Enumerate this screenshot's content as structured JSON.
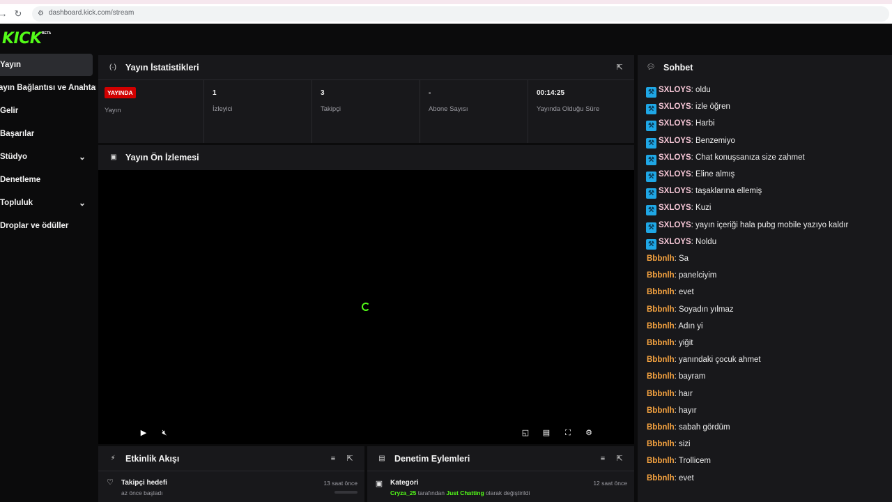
{
  "browser": {
    "back_icon": "back-arrow-icon",
    "reload_icon": "reload-icon",
    "url": "dashboard.kick.com/stream"
  },
  "brand": {
    "logo": "KICK",
    "beta": "BETA",
    "color": "#53fc18"
  },
  "sidebar": {
    "items": [
      {
        "label": "Yayın"
      },
      {
        "label": "Yayın Bağlantısı ve Anahtarı"
      },
      {
        "label": "Gelir"
      },
      {
        "label": "Başarılar"
      },
      {
        "label": "Stüdyo"
      },
      {
        "label": "Denetleme"
      },
      {
        "label": "Topluluk"
      },
      {
        "label": "Droplar ve ödüller"
      }
    ]
  },
  "stats": {
    "title": "Yayın İstatistikleri",
    "live_badge": "YAYINDA",
    "cells": [
      {
        "value": "",
        "label": "Yayın"
      },
      {
        "value": "1",
        "label": "İzleyici"
      },
      {
        "value": "3",
        "label": "Takipçi"
      },
      {
        "value": "-",
        "label": "Abone Sayısı"
      },
      {
        "value": "00:14:25",
        "label": "Yayında Olduğu Süre"
      }
    ]
  },
  "preview": {
    "title": "Yayın Ön İzlemesi"
  },
  "activity": {
    "title": "Etkinlik Akışı",
    "row_title": "Takipçi hedefi",
    "row_sub": "az önce başladı",
    "row_time": "13 saat önce"
  },
  "moderation": {
    "title": "Denetim Eylemleri",
    "row_title": "Kategori",
    "row_user": "Cryza_25",
    "row_mid": " tarafından ",
    "row_category": "Just Chatting",
    "row_end": " olarak değiştirildi",
    "row_time": "12 saat önce"
  },
  "chat": {
    "title": "Sohbet",
    "messages": [
      {
        "user": "SXLOYS",
        "text": ": oldu"
      },
      {
        "user": "SXLOYS",
        "text": ": izle öğren"
      },
      {
        "user": "SXLOYS",
        "text": ": Harbi"
      },
      {
        "user": "SXLOYS",
        "text": ": Benzemiyo"
      },
      {
        "user": "SXLOYS",
        "text": ": Chat konuşsanıza size zahmet"
      },
      {
        "user": "SXLOYS",
        "text": ": Eline almış"
      },
      {
        "user": "SXLOYS",
        "text": ": taşaklarına ellemiş"
      },
      {
        "user": "SXLOYS",
        "text": ": Kuzi"
      },
      {
        "user": "SXLOYS",
        "text": ": yayın içeriği hala pubg mobile yazıyo kaldır"
      },
      {
        "user": "SXLOYS",
        "text": ": Noldu"
      },
      {
        "user": "Bbbnlh",
        "text": ": Sa"
      },
      {
        "user": "Bbbnlh",
        "text": ": panelciyim"
      },
      {
        "user": "Bbbnlh",
        "text": ": evet"
      },
      {
        "user": "Bbbnlh",
        "text": ": Soyadın yılmaz"
      },
      {
        "user": "Bbbnlh",
        "text": ": Adın yi"
      },
      {
        "user": "Bbbnlh",
        "text": ": yiğit"
      },
      {
        "user": "Bbbnlh",
        "text": ": yanındaki çocuk ahmet"
      },
      {
        "user": "Bbbnlh",
        "text": ": bayram"
      },
      {
        "user": "Bbbnlh",
        "text": ": haır"
      },
      {
        "user": "Bbbnlh",
        "text": ": hayır"
      },
      {
        "user": "Bbbnlh",
        "text": ": sabah gördüm"
      },
      {
        "user": "Bbbnlh",
        "text": ": sizi"
      },
      {
        "user": "Bbbnlh",
        "text": ": Trollicem"
      },
      {
        "user": "Bbbnlh",
        "text": ": evet"
      }
    ]
  },
  "colors": {
    "accent": "#53fc18",
    "live": "#d10000",
    "badge": "#1fa7e6",
    "user_pink": "#f8c8d8",
    "user_orange": "#f7a440"
  }
}
